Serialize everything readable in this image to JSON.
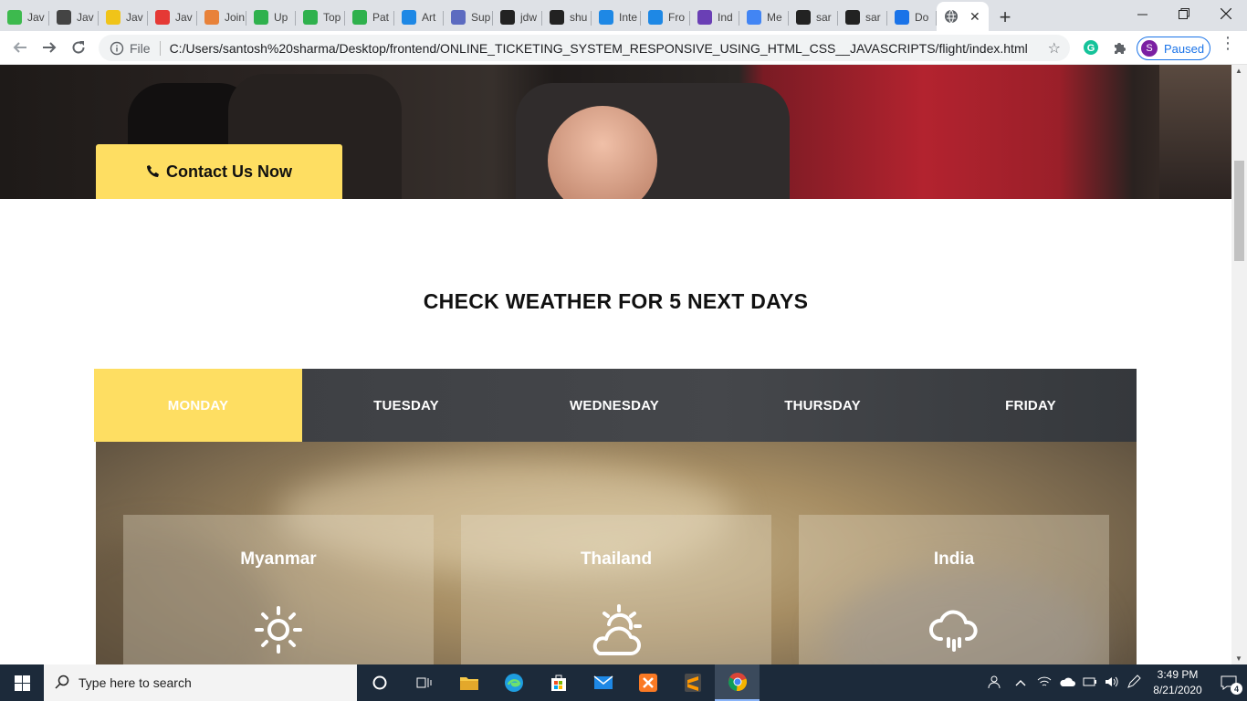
{
  "browser": {
    "tabs": [
      {
        "label": "Jav",
        "favicon": "app-icon-green",
        "color": "#3dba4e"
      },
      {
        "label": "Jav",
        "favicon": "diamond-icon",
        "color": "#444444"
      },
      {
        "label": "Jav",
        "favicon": "js-icon",
        "color": "#f0c419"
      },
      {
        "label": "Jav",
        "favicon": "v-logo-icon",
        "color": "#e53935"
      },
      {
        "label": "Join",
        "favicon": "th-logo-icon",
        "color": "#e8823a"
      },
      {
        "label": "Up",
        "favicon": "play-icon",
        "color": "#2fb14d"
      },
      {
        "label": "Top",
        "favicon": "play-icon",
        "color": "#2fb14d"
      },
      {
        "label": "Pat",
        "favicon": "play-icon",
        "color": "#2fb14d"
      },
      {
        "label": "Art",
        "favicon": "is-logo-icon",
        "color": "#1e88e5"
      },
      {
        "label": "Sup",
        "favicon": "wave-icon",
        "color": "#5c6bc0"
      },
      {
        "label": "jdw",
        "favicon": "github-icon",
        "color": "#222222"
      },
      {
        "label": "shu",
        "favicon": "github-icon",
        "color": "#222222"
      },
      {
        "label": "Inte",
        "favicon": "is-logo-icon",
        "color": "#1e88e5"
      },
      {
        "label": "Fro",
        "favicon": "is-logo-icon",
        "color": "#1e88e5"
      },
      {
        "label": "Ind",
        "favicon": "list-icon",
        "color": "#6a3fb5"
      },
      {
        "label": "Me",
        "favicon": "google-icon",
        "color": "#4285f4"
      },
      {
        "label": "sar",
        "favicon": "github-icon",
        "color": "#222222"
      },
      {
        "label": "sar",
        "favicon": "github-icon",
        "color": "#222222"
      },
      {
        "label": "Do",
        "favicon": "download-icon",
        "color": "#1a73e8"
      }
    ],
    "active_tab_favicon": "globe-icon",
    "new_tab": "+",
    "omnibox": {
      "scheme_label": "File",
      "url": "C:/Users/santosh%20sharma/Desktop/frontend/ONLINE_TICKETING_SYSTEM_RESPONSIVE_USING_HTML_CSS__JAVASCRIPTS/flight/index.html"
    },
    "profile": {
      "initial": "S",
      "status": "Paused"
    }
  },
  "page": {
    "contact_button": "Contact Us Now",
    "weather_title": "CHECK WEATHER FOR 5 NEXT DAYS",
    "days": [
      {
        "label": "MONDAY",
        "active": true
      },
      {
        "label": "TUESDAY",
        "active": false
      },
      {
        "label": "WEDNESDAY",
        "active": false
      },
      {
        "label": "THURSDAY",
        "active": false
      },
      {
        "label": "FRIDAY",
        "active": false
      }
    ],
    "cards": [
      {
        "city": "Myanmar",
        "icon": "sun-icon"
      },
      {
        "city": "Thailand",
        "icon": "partly-cloudy-icon"
      },
      {
        "city": "India",
        "icon": "rain-cloud-icon"
      }
    ],
    "accent_color": "#fede62"
  },
  "taskbar": {
    "search_placeholder": "Type here to search",
    "time": "3:49 PM",
    "date": "8/21/2020",
    "notifications": "4"
  }
}
